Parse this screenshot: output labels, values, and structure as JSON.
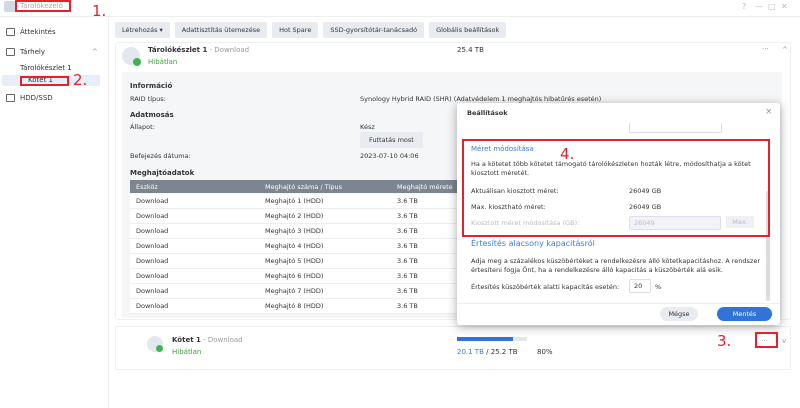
{
  "app": {
    "title": "Tárolókezelő",
    "controls": [
      "?",
      "—",
      "□",
      "✕"
    ]
  },
  "sidebar": {
    "items": [
      {
        "label": "Áttekintés"
      },
      {
        "label": "Tárhely"
      },
      {
        "label": "Tárolókészlet 1"
      },
      {
        "label": "Kötet 1"
      },
      {
        "label": "HDD/SSD"
      }
    ]
  },
  "toolbar": [
    "Létrehozás ▾",
    "Adattisztítás ütemezése",
    "Hot Spare",
    "SSD-gyorsítótár-tanácsadó",
    "Globális beállítások"
  ],
  "pool": {
    "name": "Tárolókészlet 1",
    "suffix": " - Download",
    "status": "Hibátlan",
    "size": "25.4 TB",
    "more": "···",
    "collapse": "^",
    "info_title": "Információ",
    "raid_label": "RAID típus:",
    "raid_value": "Synology Hybrid RAID (SHR) (Adatvédelem 1 meghajtós hibatűrés esetén)",
    "scrub_title": "Adatmosás",
    "state_label": "Állapot:",
    "state_value": "Kész",
    "run_now": "Futtatás most",
    "end_label": "Befejezés dátuma:",
    "end_value": "2023-07-10 04:06",
    "drives_title": "Meghajtóadatok",
    "columns": [
      "Eszköz",
      "Meghajtó száma / Típus",
      "Meghajtó mérete"
    ],
    "rows": [
      [
        "Download",
        "Meghajtó 1 (HDD)",
        "3.6 TB"
      ],
      [
        "Download",
        "Meghajtó 2 (HDD)",
        "3.6 TB"
      ],
      [
        "Download",
        "Meghajtó 3 (HDD)",
        "3.6 TB"
      ],
      [
        "Download",
        "Meghajtó 4 (HDD)",
        "3.6 TB"
      ],
      [
        "Download",
        "Meghajtó 5 (HDD)",
        "3.6 TB"
      ],
      [
        "Download",
        "Meghajtó 6 (HDD)",
        "3.6 TB"
      ],
      [
        "Download",
        "Meghajtó 7 (HDD)",
        "3.6 TB"
      ],
      [
        "Download",
        "Meghajtó 8 (HDD)",
        "3.6 TB"
      ]
    ]
  },
  "volume": {
    "name": "Kötet 1",
    "suffix": " - Download",
    "status": "Hibátlan",
    "used": "20.1 TB",
    "total": " / 25.2 TB",
    "percent": "80%",
    "usage_fraction": 0.8,
    "more": "···",
    "expand": "v"
  },
  "dialog": {
    "title": "Beállítások",
    "close": "×",
    "resize_title": "Méret módosítása",
    "resize_desc": "Ha a kötetet több kötetet támogató tárolókészleten hozták létre, módosíthatja a kötet kiosztott méretét.",
    "current_label": "Aktuálisan kiosztott méret:",
    "current_value": "26049 GB",
    "max_label": "Max. kiosztható méret:",
    "max_value": "26049 GB",
    "modify_label": "Kiosztott méret módosítása (GB):",
    "modify_value": "26049",
    "max_button": "Max.",
    "notify_title": "Értesítés alacsony kapacitásról",
    "notify_desc": "Adja meg a százalékos küszöbértéket a rendelkezésre álló kötetkapacitáshoz. A rendszer értesíteni fogja Önt, ha a rendelkezésre álló kapacitás a küszöbérték alá esik.",
    "threshold_label": "Értesítés küszöbérték alatti kapacitás esetén:",
    "threshold_value": "20",
    "threshold_unit": "%",
    "cancel": "Mégse",
    "save": "Mentés"
  },
  "annotations": [
    "1.",
    "2.",
    "3.",
    "4."
  ],
  "colors": {
    "accent": "#3d7ec9",
    "ok": "#3a9d3a",
    "annotation": "#e0232e"
  }
}
